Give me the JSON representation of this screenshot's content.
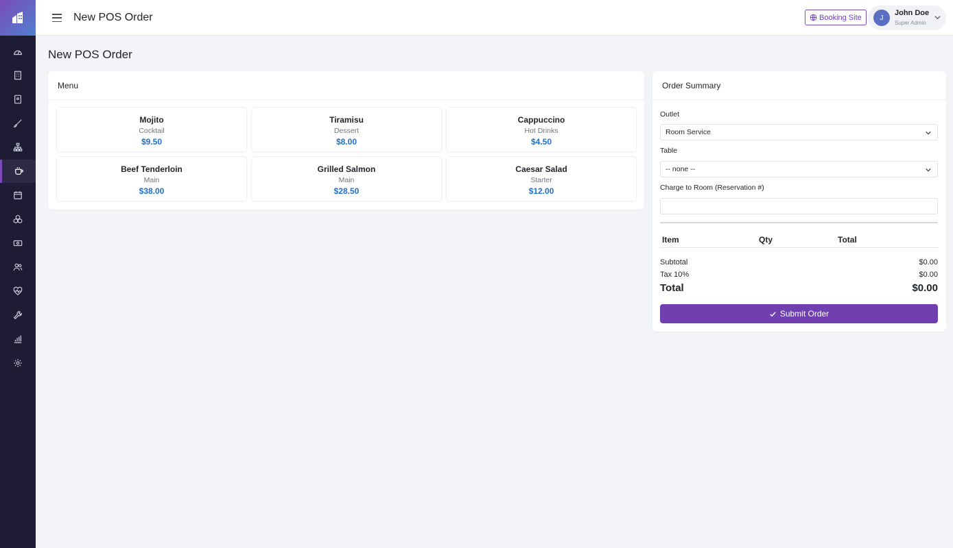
{
  "app": {
    "page_title": "New POS Order"
  },
  "sidebar": {
    "active_item": "pos",
    "items": [
      {
        "id": "dashboard",
        "icon": "gauge-icon"
      },
      {
        "id": "properties",
        "icon": "building-icon"
      },
      {
        "id": "rooms",
        "icon": "door-icon"
      },
      {
        "id": "housekeeping",
        "icon": "brush-icon"
      },
      {
        "id": "hierarchy",
        "icon": "sitemap-icon"
      },
      {
        "id": "pos",
        "icon": "coffee-cup-icon"
      },
      {
        "id": "calendar",
        "icon": "calendar-icon"
      },
      {
        "id": "amenities",
        "icon": "boxes-icon"
      },
      {
        "id": "payments",
        "icon": "cash-icon"
      },
      {
        "id": "guests",
        "icon": "users-icon"
      },
      {
        "id": "health",
        "icon": "heart-pulse-icon"
      },
      {
        "id": "maintenance",
        "icon": "wrench-icon"
      },
      {
        "id": "reports",
        "icon": "bar-chart-icon"
      },
      {
        "id": "settings",
        "icon": "gear-icon"
      }
    ]
  },
  "topbar": {
    "title": "New POS Order",
    "booking_site_label": "Booking Site",
    "user": {
      "initial": "J",
      "name": "John Doe",
      "role": "Super Admin"
    }
  },
  "menu": {
    "header": "Menu",
    "items": [
      {
        "name": "Mojito",
        "category": "Cocktail",
        "price": "$9.50"
      },
      {
        "name": "Tiramisu",
        "category": "Dessert",
        "price": "$8.00"
      },
      {
        "name": "Cappuccino",
        "category": "Hot Drinks",
        "price": "$4.50"
      },
      {
        "name": "Beef Tenderloin",
        "category": "Main",
        "price": "$38.00"
      },
      {
        "name": "Grilled Salmon",
        "category": "Main",
        "price": "$28.50"
      },
      {
        "name": "Caesar Salad",
        "category": "Starter",
        "price": "$12.00"
      }
    ]
  },
  "order": {
    "header": "Order Summary",
    "outlet_label": "Outlet",
    "outlet_value": "Room Service",
    "table_label": "Table",
    "table_value": "-- none --",
    "charge_label": "Charge to Room (Reservation #)",
    "charge_value": "",
    "columns": {
      "item": "Item",
      "qty": "Qty",
      "total": "Total"
    },
    "subtotal_label": "Subtotal",
    "subtotal_value": "$0.00",
    "tax_label": "Tax 10%",
    "tax_value": "$0.00",
    "total_label": "Total",
    "total_value": "$0.00",
    "submit_label": "Submit Order"
  },
  "colors": {
    "sidebar_bg": "#1e1b34",
    "accent": "#7040b0",
    "price": "#1f6fd1"
  }
}
